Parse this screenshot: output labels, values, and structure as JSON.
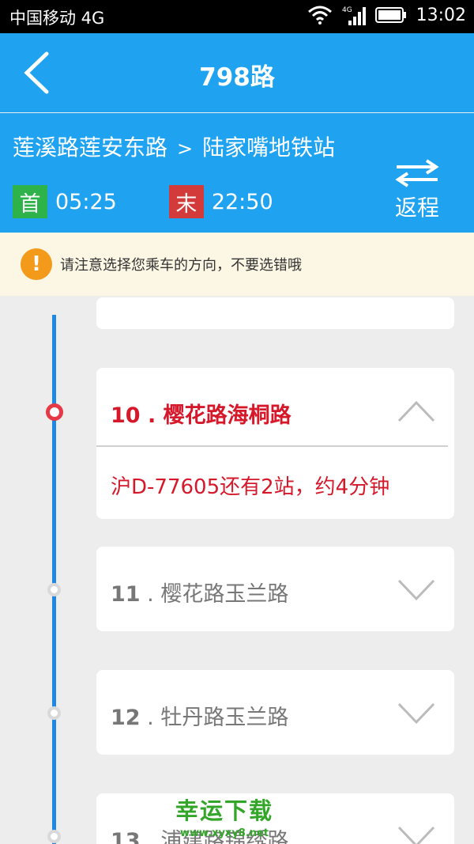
{
  "status_bar": {
    "carrier": "中国移动 4G",
    "network_badge": "4G",
    "time": "13:02"
  },
  "header": {
    "title": "798路",
    "back_icon": "chevron-left-icon"
  },
  "route": {
    "from": "莲溪路莲安东路",
    "arrow": ">",
    "to": "陆家嘴地铁站",
    "first_label": "首",
    "first_time": "05:25",
    "last_label": "末",
    "last_time": "22:50",
    "return_label": "返程"
  },
  "notice": {
    "icon": "!",
    "text": "请注意选择您乘车的方向，不要选错哦"
  },
  "stations": [
    {
      "number": "10",
      "name": "樱花路海桐路",
      "bus_info": "沪D-77605还有2站，约4分钟"
    },
    {
      "number": "11",
      "name": "樱花路玉兰路"
    },
    {
      "number": "12",
      "name": "牡丹路玉兰路"
    },
    {
      "number": "13",
      "name": "浦建路锦绣路"
    }
  ],
  "watermark": {
    "title": "幸运下载",
    "url": "www.xyxy8.net"
  },
  "colors": {
    "primary": "#1fa3f0",
    "active": "#d6182b",
    "first_badge": "#2db34a",
    "last_badge": "#d33b3b",
    "warning": "#f39a1b"
  }
}
